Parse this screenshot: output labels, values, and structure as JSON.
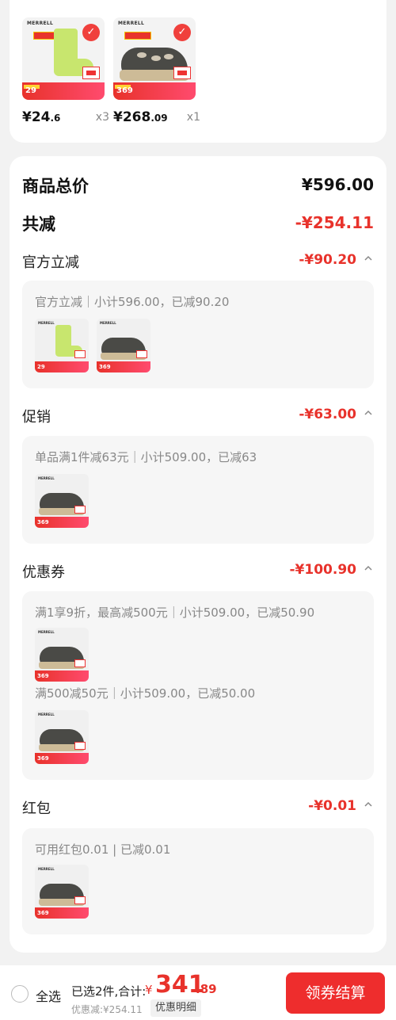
{
  "products": [
    {
      "brand": "MERRELL",
      "promo": "29",
      "price_int": "¥24",
      "price_dec": ".6",
      "qty": "x3"
    },
    {
      "brand": "MERRELL",
      "promo": "369",
      "price_int": "¥268",
      "price_dec": ".09",
      "qty": "x1"
    }
  ],
  "summary": {
    "total_label": "商品总价",
    "total_value": "¥596.00",
    "reduce_label": "共减",
    "reduce_value": "-¥254.11"
  },
  "sections": [
    {
      "label": "官方立减",
      "value": "-¥90.20",
      "desc": "官方立减｜小计596.00，已减90.20"
    },
    {
      "label": "促销",
      "value": "-¥63.00",
      "desc": "单品满1件减63元｜小计509.00，已减63"
    },
    {
      "label": "优惠券",
      "value": "-¥100.90",
      "desc": "满1享9折，最高减500元｜小计509.00，已减50.90",
      "desc2": "满500减50元｜小计509.00，已减50.00"
    },
    {
      "label": "红包",
      "value": "-¥0.01",
      "desc": "可用红包0.01 | 已减0.01"
    }
  ],
  "thumb_prices": {
    "sock": "29",
    "shoe": "369"
  },
  "bottom": {
    "select_all": "全选",
    "selected": "已选2件,合计:",
    "currency": "¥",
    "total_int": "341",
    "total_dec": ".89",
    "discount": "优惠减:¥254.11",
    "detail_link": "优惠明细",
    "checkout": "领券结算"
  },
  "colors": {
    "accent_red": "#e8322b",
    "checkout_red": "#ee2d2d",
    "sock_green": "#c8e66e"
  }
}
